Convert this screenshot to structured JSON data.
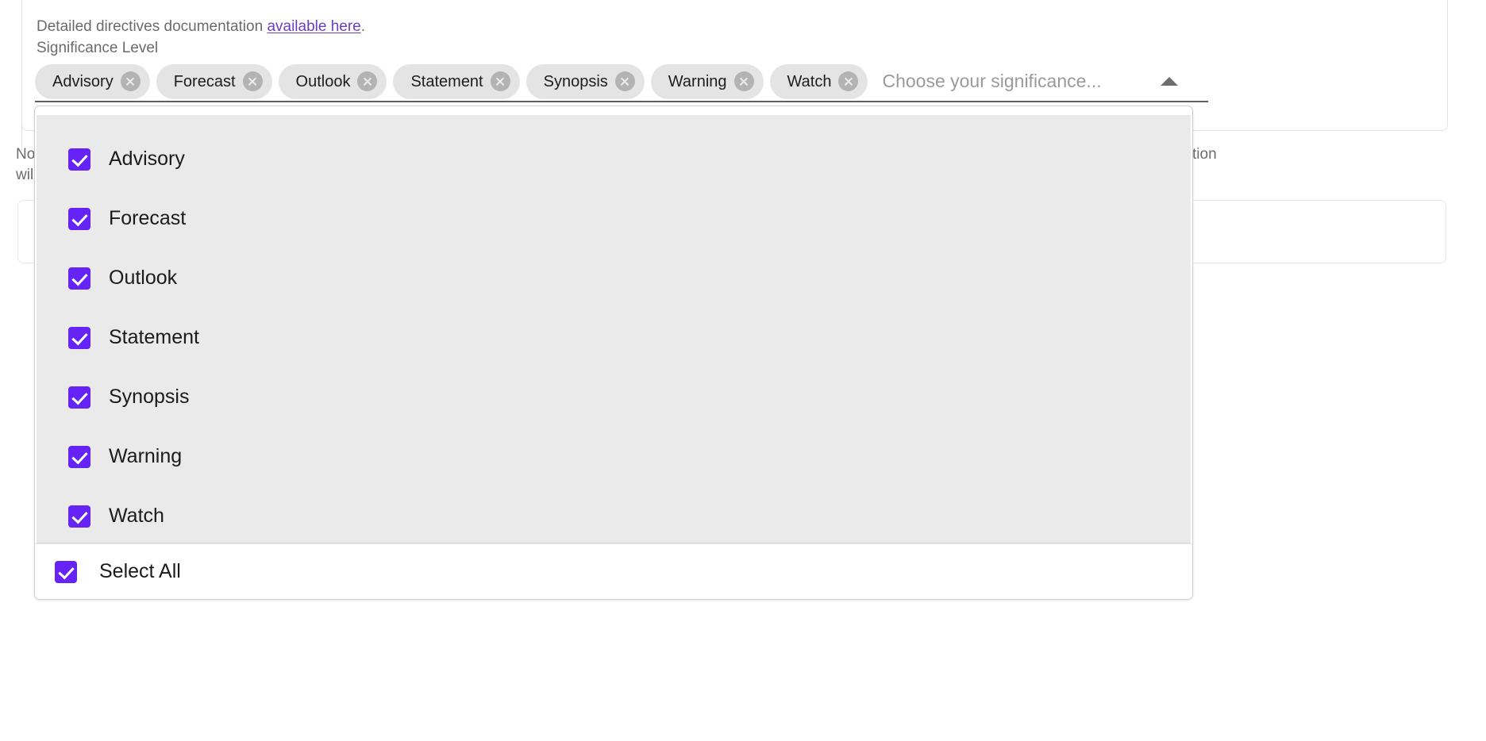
{
  "header": {
    "doc_text_before": "Detailed directives documentation ",
    "doc_link_label": "available here",
    "doc_text_after": ".",
    "field_label": "Significance Level"
  },
  "background_text": {
    "note_left_line1": "No",
    "note_left_line2": "wil",
    "note_right": "tion"
  },
  "select": {
    "placeholder": "Choose your significance...",
    "caret_icon": "chevron-up-icon",
    "chips": [
      {
        "label": "Advisory",
        "remove_icon": "close-circle-icon"
      },
      {
        "label": "Forecast",
        "remove_icon": "close-circle-icon"
      },
      {
        "label": "Outlook",
        "remove_icon": "close-circle-icon"
      },
      {
        "label": "Statement",
        "remove_icon": "close-circle-icon"
      },
      {
        "label": "Synopsis",
        "remove_icon": "close-circle-icon"
      },
      {
        "label": "Warning",
        "remove_icon": "close-circle-icon"
      },
      {
        "label": "Watch",
        "remove_icon": "close-circle-icon"
      }
    ]
  },
  "dropdown": {
    "options": [
      {
        "label": "Advisory",
        "checked": true
      },
      {
        "label": "Forecast",
        "checked": true
      },
      {
        "label": "Outlook",
        "checked": true
      },
      {
        "label": "Statement",
        "checked": true
      },
      {
        "label": "Synopsis",
        "checked": true
      },
      {
        "label": "Warning",
        "checked": true
      },
      {
        "label": "Watch",
        "checked": true
      }
    ],
    "select_all": {
      "label": "Select All",
      "checked": true
    }
  },
  "colors": {
    "checkbox_purple": "#6524f5",
    "link_purple": "#6a3fc4",
    "chip_grey": "#e4e4e4",
    "list_grey": "#eaeaea"
  }
}
